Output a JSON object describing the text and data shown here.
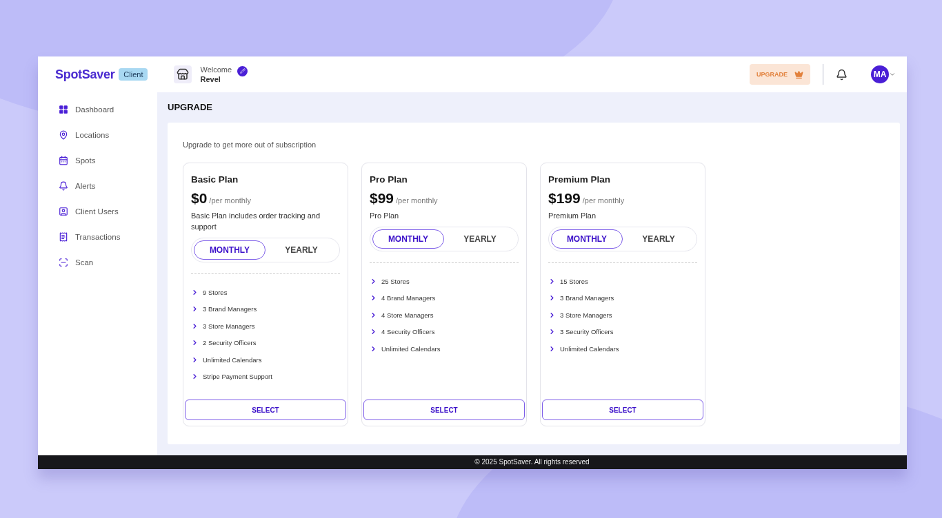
{
  "header": {
    "logo": "SpotSaver",
    "role_badge": "Client",
    "welcome": "Welcome",
    "user_name": "Revel",
    "upgrade_button": "UPGRADE",
    "avatar_initials": "MA"
  },
  "sidebar": {
    "items": [
      {
        "label": "Dashboard",
        "kind": "grid"
      },
      {
        "label": "Locations",
        "kind": "pin"
      },
      {
        "label": "Spots",
        "kind": "calendar"
      },
      {
        "label": "Alerts",
        "kind": "bell"
      },
      {
        "label": "Client Users",
        "kind": "user"
      },
      {
        "label": "Transactions",
        "kind": "receipt"
      },
      {
        "label": "Scan",
        "kind": "scan"
      }
    ]
  },
  "page_title": "UPGRADE",
  "subtitle": "Upgrade to get more out of subscription",
  "plans": [
    {
      "name": "Basic Plan",
      "price": "$0",
      "period": "/per monthly",
      "description": "Basic Plan includes order tracking and support",
      "billing": [
        {
          "label": "MONTHLY",
          "selected": true
        },
        {
          "label": "YEARLY",
          "selected": false
        }
      ],
      "features": [
        "9 Stores",
        "3 Brand Managers",
        "3 Store Managers",
        "2 Security Officers",
        "Unlimited Calendars",
        "Stripe Payment Support"
      ],
      "button": "SELECT"
    },
    {
      "name": "Pro Plan",
      "price": "$99",
      "period": "/per monthly",
      "description": "Pro Plan",
      "billing": [
        {
          "label": "MONTHLY",
          "selected": true
        },
        {
          "label": "YEARLY",
          "selected": false
        }
      ],
      "features": [
        "25 Stores",
        "4 Brand Managers",
        "4 Store Managers",
        "4 Security Officers",
        "Unlimited Calendars"
      ],
      "button": "SELECT"
    },
    {
      "name": "Premium Plan",
      "price": "$199",
      "period": "/per monthly",
      "description": "Premium Plan",
      "billing": [
        {
          "label": "MONTHLY",
          "selected": true
        },
        {
          "label": "YEARLY",
          "selected": false
        }
      ],
      "features": [
        "15 Stores",
        "3 Brand Managers",
        "3 Store Managers",
        "3 Security Officers",
        "Unlimited Calendars"
      ],
      "button": "SELECT"
    }
  ],
  "footer": "© 2025 SpotSaver. All rights reserved"
}
